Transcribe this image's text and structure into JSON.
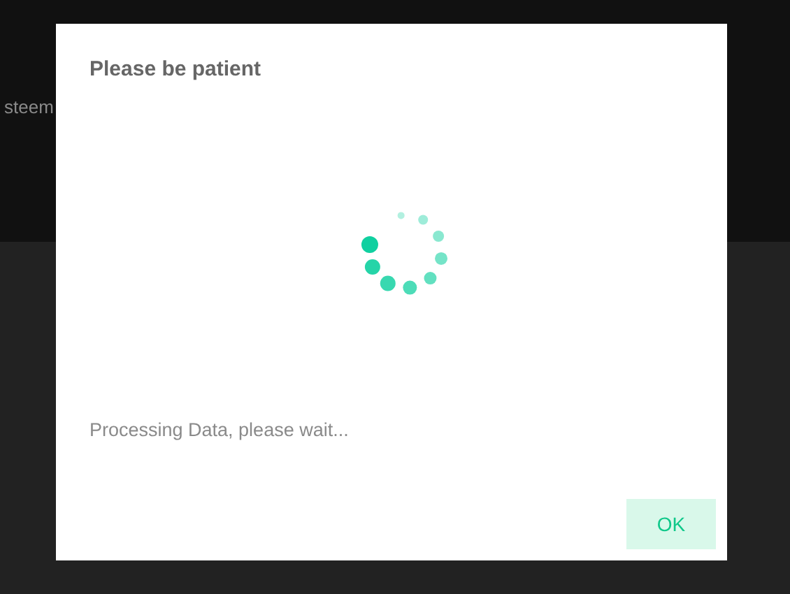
{
  "background": {
    "text": "steem"
  },
  "dialog": {
    "title": "Please be patient",
    "message": "Processing Data, please wait...",
    "buttons": [
      "OK"
    ]
  }
}
